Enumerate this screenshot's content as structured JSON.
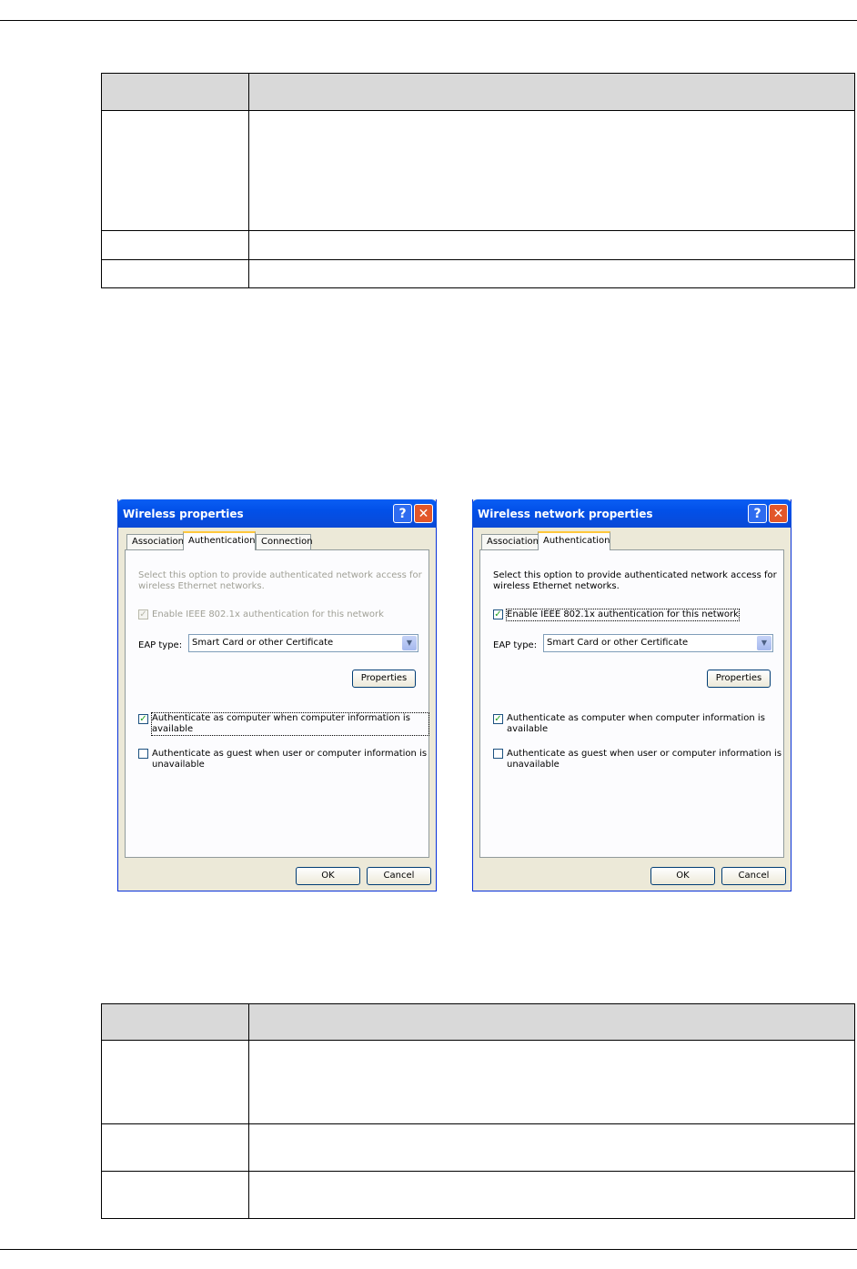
{
  "dialog_left": {
    "title": "Wireless properties",
    "tabs": [
      "Association",
      "Authentication",
      "Connection"
    ],
    "selected_tab": "Authentication",
    "description": "Select this option to provide authenticated network access for wireless Ethernet networks.",
    "description_line1": "Select this option to provide authenticated network access for",
    "description_line2": "wireless Ethernet networks.",
    "enable_8021x_label": "Enable IEEE 802.1x authentication for this network",
    "enable_8021x_checked": true,
    "enable_8021x_disabled": true,
    "eap_type_label": "EAP type:",
    "eap_type_value": "Smart Card or other Certificate",
    "properties_button": "Properties",
    "auth_computer_label": "Authenticate as computer when computer information is available",
    "auth_computer_checked": true,
    "auth_guest_line1": "Authenticate as guest when user or computer information is",
    "auth_guest_line2": "unavailable",
    "auth_guest_checked": false,
    "ok_button": "OK",
    "cancel_button": "Cancel",
    "help_glyph": "?",
    "close_glyph": "✕",
    "check_glyph": "✓",
    "arrow_glyph": "▼"
  },
  "dialog_right": {
    "title": "Wireless network properties",
    "tabs": [
      "Association",
      "Authentication"
    ],
    "selected_tab": "Authentication",
    "description_line1": "Select this option to provide authenticated network access for",
    "description_line2": "wireless Ethernet networks.",
    "enable_8021x_label": "Enable IEEE 802.1x authentication for this network",
    "enable_8021x_checked": true,
    "eap_type_label": "EAP type:",
    "eap_type_value": "Smart Card or other Certificate",
    "properties_button": "Properties",
    "auth_computer_label": "Authenticate as computer when computer information is available",
    "auth_computer_checked": true,
    "auth_guest_line1": "Authenticate as guest when user or computer information is",
    "auth_guest_line2": "unavailable",
    "auth_guest_checked": false,
    "ok_button": "OK",
    "cancel_button": "Cancel",
    "help_glyph": "?",
    "close_glyph": "✕",
    "check_glyph": "✓",
    "arrow_glyph": "▼"
  },
  "colors": {
    "titlebar": "#0a5ef4",
    "dialog_bg": "#ece9d8",
    "table_header": "#d9d9d9",
    "checkmark": "#21a121",
    "tab_highlight": "#ffc83c"
  }
}
